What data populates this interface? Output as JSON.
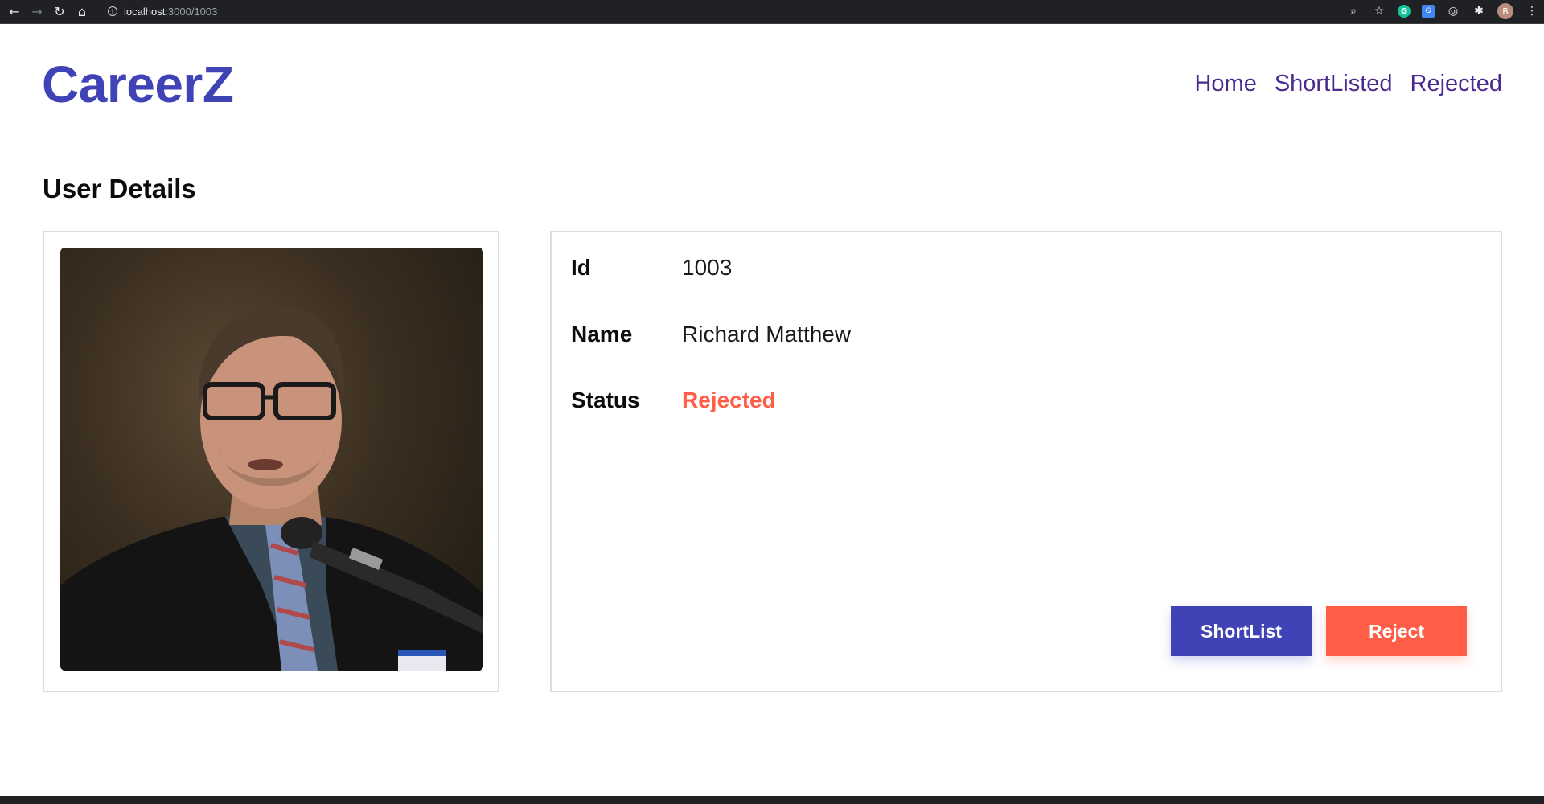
{
  "browser": {
    "url_host": "localhost",
    "url_path": ":3000/1003",
    "avatar_letter": "B",
    "grammarly_letter": "G"
  },
  "brand": "CareerZ",
  "nav": {
    "home": "Home",
    "shortlisted": "ShortListed",
    "rejected": "Rejected"
  },
  "page_title": "User Details",
  "details": {
    "id_label": "Id",
    "id_value": "1003",
    "name_label": "Name",
    "name_value": "Richard Matthew",
    "status_label": "Status",
    "status_value": "Rejected"
  },
  "buttons": {
    "shortlist": "ShortList",
    "reject": "Reject"
  },
  "colors": {
    "brand": "#3f43b5",
    "reject": "#ff5d45",
    "nav_link": "#4b2a8f"
  }
}
